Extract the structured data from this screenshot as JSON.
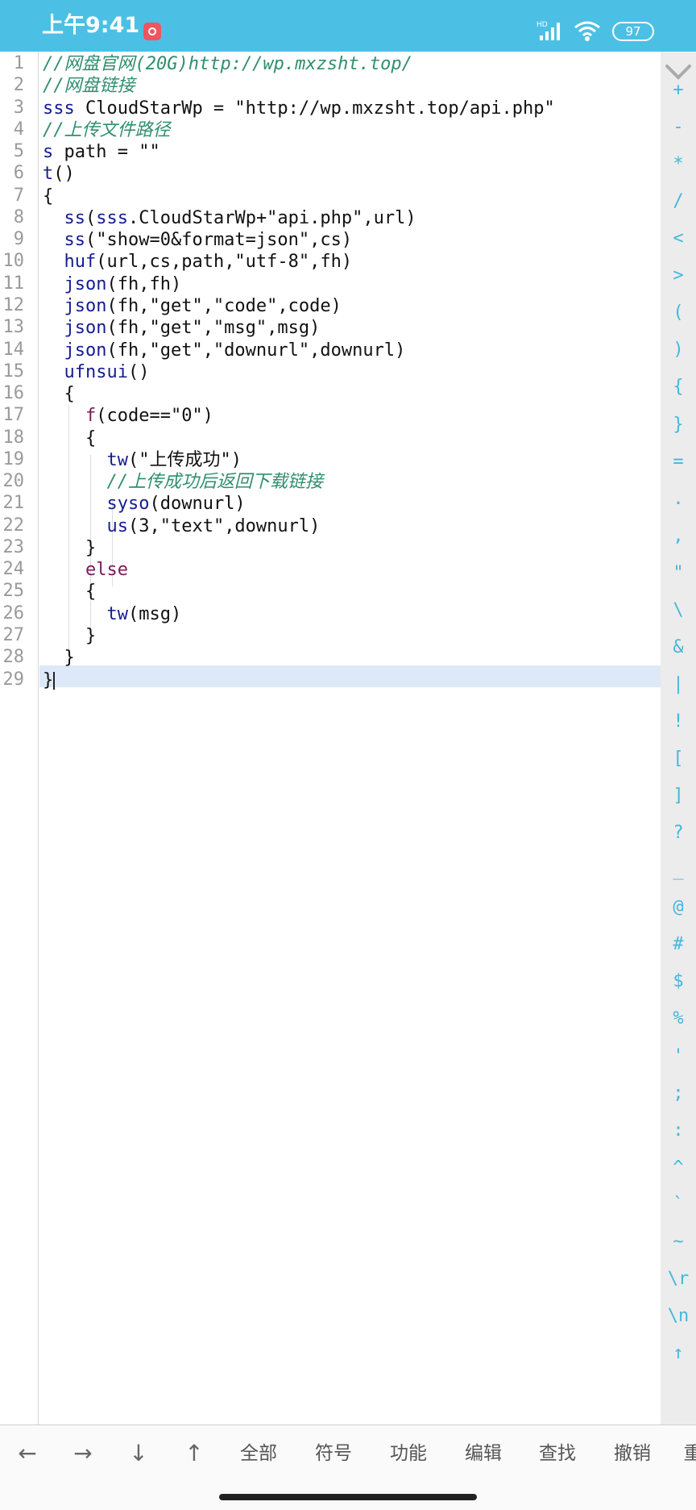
{
  "status_bar": {
    "time": "上午9:41",
    "network_label": "HD",
    "battery": "97"
  },
  "editor": {
    "line_numbers": [
      "1",
      "2",
      "3",
      "4",
      "5",
      "6",
      "7",
      "8",
      "9",
      "10",
      "11",
      "12",
      "13",
      "14",
      "15",
      "16",
      "17",
      "18",
      "19",
      "20",
      "21",
      "22",
      "23",
      "24",
      "25",
      "26",
      "27",
      "28",
      "29"
    ],
    "lines": [
      {
        "tokens": [
          {
            "t": "//网盘官网(20G)http://wp.mxzsht.top/",
            "c": "cm"
          }
        ]
      },
      {
        "tokens": [
          {
            "t": "//网盘链接",
            "c": "cm"
          }
        ]
      },
      {
        "tokens": [
          {
            "t": "sss",
            "c": "kw"
          },
          {
            "t": " CloudStarWp = \"http://wp.mxzsht.top/api.php\"",
            "c": ""
          }
        ]
      },
      {
        "tokens": [
          {
            "t": "//上传文件路径",
            "c": "cm"
          }
        ]
      },
      {
        "tokens": [
          {
            "t": "s",
            "c": "kw"
          },
          {
            "t": " path = \"\"",
            "c": ""
          }
        ]
      },
      {
        "tokens": [
          {
            "t": "t",
            "c": "kw"
          },
          {
            "t": "()",
            "c": ""
          }
        ]
      },
      {
        "tokens": [
          {
            "t": "{",
            "c": ""
          }
        ]
      },
      {
        "tokens": [
          {
            "t": "  ",
            "c": ""
          },
          {
            "t": "ss",
            "c": "kw"
          },
          {
            "t": "(",
            "c": ""
          },
          {
            "t": "sss",
            "c": "kw"
          },
          {
            "t": ".CloudStarWp+\"api.php\",url)",
            "c": ""
          }
        ]
      },
      {
        "tokens": [
          {
            "t": "  ",
            "c": ""
          },
          {
            "t": "ss",
            "c": "kw"
          },
          {
            "t": "(\"show=0&format=json\",cs)",
            "c": ""
          }
        ]
      },
      {
        "tokens": [
          {
            "t": "  ",
            "c": ""
          },
          {
            "t": "huf",
            "c": "kw"
          },
          {
            "t": "(url,cs,path,\"utf-8\",fh)",
            "c": ""
          }
        ]
      },
      {
        "tokens": [
          {
            "t": "  ",
            "c": ""
          },
          {
            "t": "json",
            "c": "kw"
          },
          {
            "t": "(fh,fh)",
            "c": ""
          }
        ]
      },
      {
        "tokens": [
          {
            "t": "  ",
            "c": ""
          },
          {
            "t": "json",
            "c": "kw"
          },
          {
            "t": "(fh,\"get\",\"code\",code)",
            "c": ""
          }
        ]
      },
      {
        "tokens": [
          {
            "t": "  ",
            "c": ""
          },
          {
            "t": "json",
            "c": "kw"
          },
          {
            "t": "(fh,\"get\",\"msg\",msg)",
            "c": ""
          }
        ]
      },
      {
        "tokens": [
          {
            "t": "  ",
            "c": ""
          },
          {
            "t": "json",
            "c": "kw"
          },
          {
            "t": "(fh,\"get\",\"downurl\",downurl)",
            "c": ""
          }
        ]
      },
      {
        "tokens": [
          {
            "t": "  ",
            "c": ""
          },
          {
            "t": "ufnsui",
            "c": "kw"
          },
          {
            "t": "()",
            "c": ""
          }
        ]
      },
      {
        "tokens": [
          {
            "t": "  {",
            "c": ""
          }
        ]
      },
      {
        "tokens": [
          {
            "t": "    ",
            "c": ""
          },
          {
            "t": "f",
            "c": "kw2"
          },
          {
            "t": "(code==\"0\")",
            "c": ""
          }
        ]
      },
      {
        "tokens": [
          {
            "t": "    {",
            "c": ""
          }
        ]
      },
      {
        "tokens": [
          {
            "t": "      ",
            "c": ""
          },
          {
            "t": "tw",
            "c": "kw"
          },
          {
            "t": "(\"上传成功\")",
            "c": ""
          }
        ]
      },
      {
        "tokens": [
          {
            "t": "      ",
            "c": ""
          },
          {
            "t": "//上传成功后返回下载链接",
            "c": "cm"
          }
        ]
      },
      {
        "tokens": [
          {
            "t": "      ",
            "c": ""
          },
          {
            "t": "syso",
            "c": "kw"
          },
          {
            "t": "(downurl)",
            "c": ""
          }
        ]
      },
      {
        "tokens": [
          {
            "t": "      ",
            "c": ""
          },
          {
            "t": "us",
            "c": "kw"
          },
          {
            "t": "(3,\"text\",downurl)",
            "c": ""
          }
        ]
      },
      {
        "tokens": [
          {
            "t": "    }",
            "c": ""
          }
        ]
      },
      {
        "tokens": [
          {
            "t": "    ",
            "c": ""
          },
          {
            "t": "else",
            "c": "kw2"
          }
        ]
      },
      {
        "tokens": [
          {
            "t": "    {",
            "c": ""
          }
        ]
      },
      {
        "tokens": [
          {
            "t": "      ",
            "c": ""
          },
          {
            "t": "tw",
            "c": "kw"
          },
          {
            "t": "(msg)",
            "c": ""
          }
        ]
      },
      {
        "tokens": [
          {
            "t": "    }",
            "c": ""
          }
        ]
      },
      {
        "tokens": [
          {
            "t": "  }",
            "c": ""
          }
        ]
      },
      {
        "tokens": [
          {
            "t": "}",
            "c": ""
          }
        ]
      }
    ]
  },
  "symbols": [
    "+",
    "-",
    "*",
    "/",
    "<",
    ">",
    "(",
    ")",
    "{",
    "}",
    "=",
    ".",
    ",",
    "\"",
    "\\",
    "&",
    "|",
    "!",
    "[",
    "]",
    "?",
    "_",
    "@",
    "#",
    "$",
    "%",
    "'",
    ";",
    ":",
    "^",
    "`",
    "~",
    "\\r",
    "\\n",
    "↑"
  ],
  "toolbar": [
    {
      "label": "←",
      "name": "arrow-left-button"
    },
    {
      "label": "→",
      "name": "arrow-right-button"
    },
    {
      "label": "↓",
      "name": "arrow-down-button"
    },
    {
      "label": "↑",
      "name": "arrow-up-button"
    },
    {
      "label": "全部",
      "name": "select-all-button"
    },
    {
      "label": "符号",
      "name": "symbols-button"
    },
    {
      "label": "功能",
      "name": "functions-button"
    },
    {
      "label": "编辑",
      "name": "edit-button"
    },
    {
      "label": "查找",
      "name": "find-button"
    },
    {
      "label": "撤销",
      "name": "undo-button"
    },
    {
      "label": "重",
      "name": "redo-button"
    }
  ],
  "colors": {
    "status_bar": "#4cc0e4",
    "keyword": "#151d8f",
    "control_keyword": "#7a1a5a",
    "comment": "#2e8f6e",
    "symbol": "#44b7dd",
    "current_line": "#dde9f8"
  }
}
